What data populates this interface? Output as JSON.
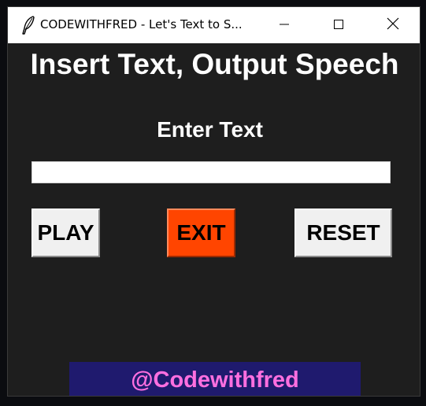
{
  "window": {
    "title": "CODEWITHFRED - Let's Text to S..."
  },
  "app": {
    "heading": "Insert Text, Output Speech",
    "input_label": "Enter Text",
    "input_value": "",
    "buttons": {
      "play": "PLAY",
      "exit": "EXIT",
      "reset": "RESET"
    },
    "footer": "@Codewithfred"
  },
  "icons": {
    "app": "feather-icon",
    "minimize": "minimize-icon",
    "maximize": "maximize-icon",
    "close": "close-icon"
  },
  "colors": {
    "background": "#1e1e1e",
    "exit_button": "#ff4500",
    "button_default": "#f0f0f0",
    "footer_bg": "#1f1a6e",
    "footer_text": "#ff6fe0"
  }
}
